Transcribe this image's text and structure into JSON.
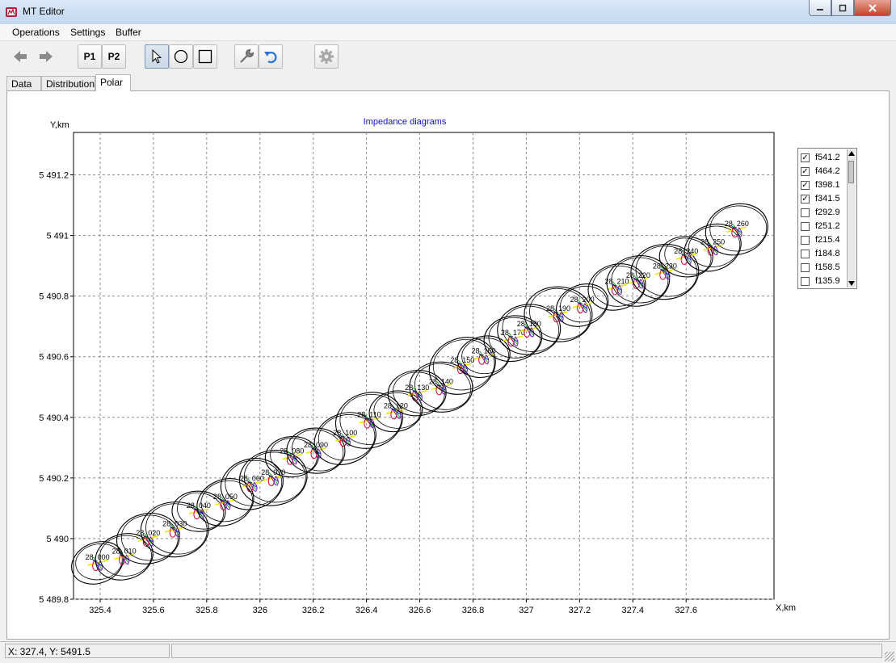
{
  "window": {
    "title": "MT Editor",
    "min_icon": "minimize-icon",
    "max_icon": "maximize-icon",
    "close_icon": "close-icon"
  },
  "menu": [
    "Operations",
    "Settings",
    "Buffer"
  ],
  "toolbar": {
    "back_icon": "arrow-left-icon",
    "forward_icon": "arrow-right-icon",
    "p1_label": "P1",
    "p2_label": "P2",
    "pointer_icon": "cursor-arrow-icon",
    "circle_icon": "circle-icon",
    "square_icon": "square-icon",
    "wrench_icon": "wrench-icon",
    "undo_icon": "undo-icon",
    "gear_icon": "gear-icon"
  },
  "tabs": [
    "Data",
    "Distribution",
    "Polar"
  ],
  "active_tab": "Polar",
  "legend": {
    "items": [
      {
        "label": "f541.2",
        "checked": true
      },
      {
        "label": "f464.2",
        "checked": true
      },
      {
        "label": "f398.1",
        "checked": true
      },
      {
        "label": "f341.5",
        "checked": true
      },
      {
        "label": "f292.9",
        "checked": false
      },
      {
        "label": "f251.2",
        "checked": false
      },
      {
        "label": "f215.4",
        "checked": false
      },
      {
        "label": "f184.8",
        "checked": false
      },
      {
        "label": "f158.5",
        "checked": false
      },
      {
        "label": "f135.9",
        "checked": false
      }
    ]
  },
  "chart_data": {
    "type": "scatter",
    "title": "Impedance diagrams",
    "xlabel": "X,km",
    "ylabel": "Y,km",
    "xlim": [
      325.3,
      327.93
    ],
    "ylim": [
      5489.8,
      5491.34
    ],
    "x_ticks": [
      325.4,
      325.6,
      325.8,
      326,
      326.2,
      326.4,
      326.6,
      326.8,
      327,
      327.2,
      327.4,
      327.6
    ],
    "x_tick_labels": [
      "325.4",
      "325.6",
      "325.8",
      "326",
      "326.2",
      "326.4",
      "326.6",
      "326.8",
      "327",
      "327.2",
      "327.4",
      "327.6"
    ],
    "y_ticks": [
      5489.8,
      5490,
      5490.2,
      5490.4,
      5490.6,
      5490.8,
      5491,
      5491.2
    ],
    "y_tick_labels": [
      "5 489.8",
      "5 490",
      "5 490.2",
      "5 490.4",
      "5 490.6",
      "5 490.8",
      "5 491",
      "5 491.2"
    ],
    "grid": true,
    "stations": [
      {
        "label": "28_000",
        "x": 325.39,
        "y": 5489.92
      },
      {
        "label": "28_010",
        "x": 325.49,
        "y": 5489.94
      },
      {
        "label": "28_020",
        "x": 325.58,
        "y": 5490.0
      },
      {
        "label": "28_030",
        "x": 325.68,
        "y": 5490.03
      },
      {
        "label": "28_040",
        "x": 325.77,
        "y": 5490.09
      },
      {
        "label": "28_050",
        "x": 325.87,
        "y": 5490.12
      },
      {
        "label": "28_060",
        "x": 325.97,
        "y": 5490.18
      },
      {
        "label": "28_070",
        "x": 326.05,
        "y": 5490.2
      },
      {
        "label": "28_080",
        "x": 326.12,
        "y": 5490.27
      },
      {
        "label": "28_090",
        "x": 326.21,
        "y": 5490.29
      },
      {
        "label": "28_100",
        "x": 326.32,
        "y": 5490.33
      },
      {
        "label": "28_110",
        "x": 326.41,
        "y": 5490.39
      },
      {
        "label": "28_120",
        "x": 326.51,
        "y": 5490.42
      },
      {
        "label": "28_130",
        "x": 326.59,
        "y": 5490.48
      },
      {
        "label": "28_140",
        "x": 326.68,
        "y": 5490.5
      },
      {
        "label": "28_150",
        "x": 326.76,
        "y": 5490.57
      },
      {
        "label": "28_160",
        "x": 326.84,
        "y": 5490.6
      },
      {
        "label": "28_170",
        "x": 326.95,
        "y": 5490.66
      },
      {
        "label": "28_180",
        "x": 327.01,
        "y": 5490.69
      },
      {
        "label": "28_190",
        "x": 327.12,
        "y": 5490.74
      },
      {
        "label": "28_200",
        "x": 327.21,
        "y": 5490.77
      },
      {
        "label": "28_210",
        "x": 327.34,
        "y": 5490.83
      },
      {
        "label": "28_220",
        "x": 327.42,
        "y": 5490.85
      },
      {
        "label": "28_230",
        "x": 327.52,
        "y": 5490.88
      },
      {
        "label": "28_240",
        "x": 327.6,
        "y": 5490.93
      },
      {
        "label": "28_250",
        "x": 327.7,
        "y": 5490.96
      },
      {
        "label": "28_260",
        "x": 327.79,
        "y": 5491.02
      }
    ]
  },
  "status": {
    "coords": "X: 327.4, Y: 5491.5",
    "grip_icon": "resize-grip-icon"
  }
}
